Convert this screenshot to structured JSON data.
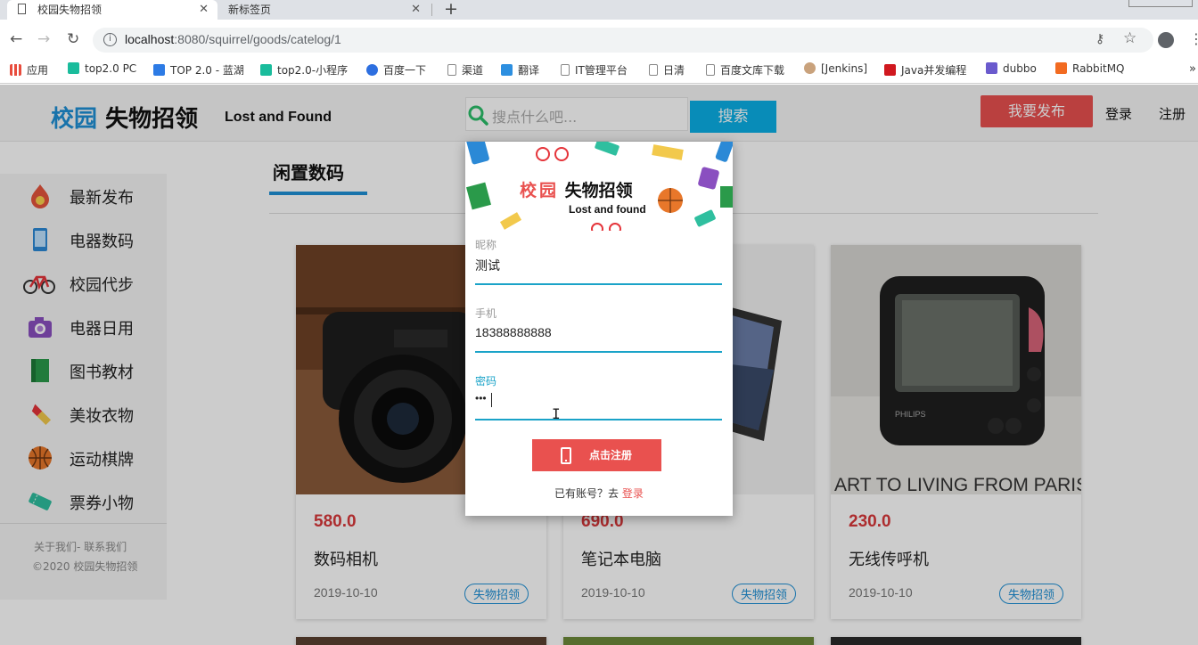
{
  "browser": {
    "tabs": [
      {
        "label": "校园失物招领",
        "active": true
      },
      {
        "label": "新标签页",
        "active": false
      }
    ],
    "url_host": "localhost",
    "url_path": ":8080/squirrel/goods/catelog/1",
    "bookmarks": [
      {
        "label": "应用",
        "icon": "apps-grid-icon",
        "color": "#e84c3d"
      },
      {
        "label": "top2.0 PC",
        "icon": "play-icon",
        "color": "#1abc9c"
      },
      {
        "label": "TOP 2.0 - 蓝湖",
        "icon": "lanhu-icon",
        "color": "#2d7be5"
      },
      {
        "label": "top2.0-小程序",
        "icon": "play-icon",
        "color": "#1abc9c"
      },
      {
        "label": "百度一下",
        "icon": "baidu-paw-icon",
        "color": "#2d6fe0"
      },
      {
        "label": "渠道",
        "icon": "page-icon",
        "color": "#888888"
      },
      {
        "label": "翻译",
        "icon": "translate-icon",
        "color": "#2d8fe0"
      },
      {
        "label": "IT管理平台",
        "icon": "page-icon",
        "color": "#888888"
      },
      {
        "label": "日清",
        "icon": "page-icon",
        "color": "#888888"
      },
      {
        "label": "百度文库下载",
        "icon": "page-icon",
        "color": "#888888"
      },
      {
        "label": "[Jenkins]",
        "icon": "jenkins-icon",
        "color": "#c9a27c"
      },
      {
        "label": "Java并发编程",
        "icon": "c-logo-icon",
        "color": "#d0181f"
      },
      {
        "label": "dubbo",
        "icon": "d-logo-icon",
        "color": "#6a5acd"
      },
      {
        "label": "RabbitMQ",
        "icon": "rabbitmq-icon",
        "color": "#f26b21"
      }
    ]
  },
  "header": {
    "logo_blue": "校园",
    "logo_black": "失物招领",
    "logo_en": "Lost and Found",
    "search_placeholder": "搜点什么吧...",
    "search_button": "搜索",
    "publish_button": "我要发布",
    "login": "登录",
    "register": "注册"
  },
  "sidebar": {
    "items": [
      {
        "label": "最新发布",
        "icon": "fire-icon"
      },
      {
        "label": "电器数码",
        "icon": "phone-icon"
      },
      {
        "label": "校园代步",
        "icon": "bicycle-icon"
      },
      {
        "label": "电器日用",
        "icon": "camera-icon"
      },
      {
        "label": "图书教材",
        "icon": "book-icon"
      },
      {
        "label": "美妆衣物",
        "icon": "lipstick-icon"
      },
      {
        "label": "运动棋牌",
        "icon": "basketball-icon"
      },
      {
        "label": "票券小物",
        "icon": "ticket-icon"
      }
    ],
    "footer_links": "关于我们- 联系我们",
    "footer_copy": "©2020 校园失物招领"
  },
  "category": {
    "title": "闲置数码"
  },
  "products": [
    {
      "price": "580.0",
      "title": "数码相机",
      "date": "2019-10-10",
      "badge": "失物招领",
      "image": "camera-photo"
    },
    {
      "price": "690.0",
      "title": "笔记本电脑",
      "date": "2019-10-10",
      "badge": "失物招领",
      "image": "laptop-photo"
    },
    {
      "price": "230.0",
      "title": "无线传呼机",
      "date": "2019-10-10",
      "badge": "失物招领",
      "image": "pager-photo"
    }
  ],
  "modal": {
    "title_red": "校园",
    "title_black": "失物招领",
    "subtitle": "Lost and found",
    "nickname_label": "昵称",
    "nickname_value": "测试",
    "phone_label": "手机",
    "phone_value": "18388888888",
    "password_label": "密码",
    "password_value": "•••",
    "register_button": "点击注册",
    "have_account": "已有账号？去 ",
    "login_link": "登录"
  },
  "colors": {
    "accent_blue": "#1e90d6",
    "accent_red": "#e9514f",
    "input_focus": "#1aa3c8",
    "price_red": "#d9383a"
  }
}
